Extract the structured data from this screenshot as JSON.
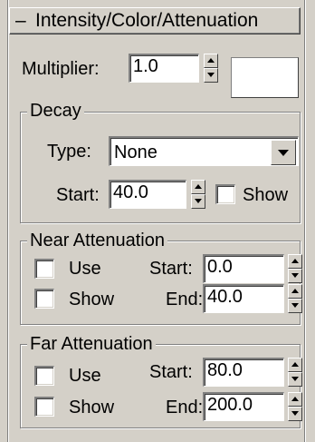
{
  "rollout": {
    "collapse_symbol": "–",
    "title": "Intensity/Color/Attenuation",
    "multiplier_label": "Multiplier:",
    "multiplier_value": "1.0",
    "color": "#ffffff"
  },
  "decay": {
    "legend": "Decay",
    "type_label": "Type:",
    "type_value": "None",
    "start_label": "Start:",
    "start_value": "40.0",
    "show_label": "Show",
    "show_checked": false
  },
  "near_attenuation": {
    "legend": "Near Attenuation",
    "use_label": "Use",
    "show_label": "Show",
    "start_label": "Start:",
    "start_value": "0.0",
    "end_label": "End:",
    "end_value": "40.0",
    "use_checked": false,
    "show_checked": false
  },
  "far_attenuation": {
    "legend": "Far Attenuation",
    "use_label": "Use",
    "show_label": "Show",
    "start_label": "Start:",
    "start_value": "80.0",
    "end_label": "End:",
    "end_value": "200.0",
    "use_checked": false,
    "show_checked": false
  }
}
